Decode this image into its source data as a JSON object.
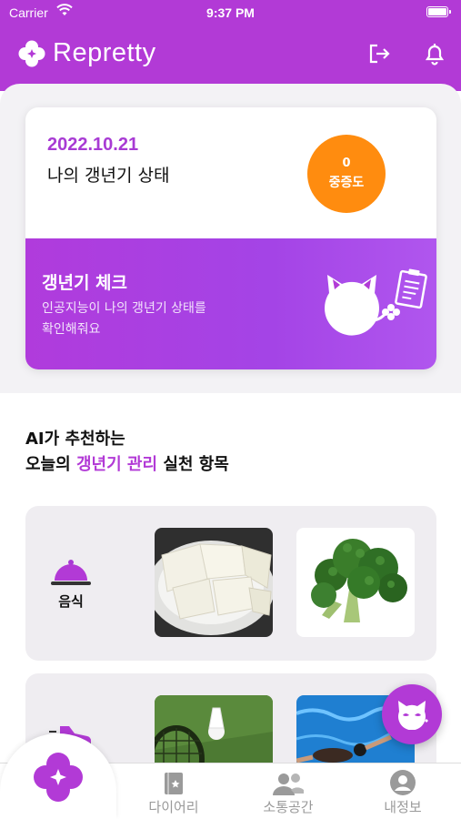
{
  "statusbar": {
    "carrier": "Carrier",
    "time": "9:37 PM"
  },
  "header": {
    "app_name": "Repretty"
  },
  "status_card": {
    "date": "2022.10.21",
    "title": "나의 갱년기 상태",
    "severity_value": "0",
    "severity_label": "중증도"
  },
  "check_card": {
    "title": "갱년기 체크",
    "description_line1": "인공지능이 나의 갱년기 상태를",
    "description_line2": "확인해줘요"
  },
  "recommendation": {
    "line1": "AI가 추천하는",
    "line2_prefix": "오늘의",
    "line2_highlight": "갱년기 관리",
    "line2_suffix": "실천 항목"
  },
  "categories": [
    {
      "label": "음식",
      "items": [
        "tofu",
        "broccoli"
      ]
    },
    {
      "label": "",
      "items": [
        "badminton",
        "swimming"
      ]
    }
  ],
  "tabbar": {
    "items": [
      {
        "label": "다이어리"
      },
      {
        "label": "소통공간"
      },
      {
        "label": "내정보"
      }
    ]
  },
  "colors": {
    "brand": "#b23ad6",
    "severity": "#ff8c0f",
    "panel": "#f3f2f5"
  }
}
